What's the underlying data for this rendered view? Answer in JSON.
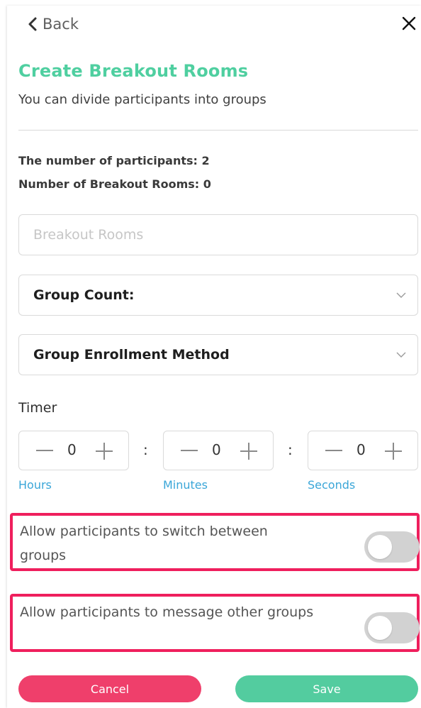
{
  "nav": {
    "back_label": "Back"
  },
  "header": {
    "title": "Create Breakout Rooms",
    "subtitle": "You can divide participants into groups"
  },
  "stats": {
    "participants": "The number of participants: 2",
    "rooms": "Number of Breakout Rooms: 0"
  },
  "form": {
    "name_placeholder": "Breakout Rooms",
    "group_count_label": "Group Count:",
    "enrollment_label": "Group Enrollment Method"
  },
  "timer": {
    "label": "Timer",
    "hours": {
      "value": "0",
      "label": "Hours"
    },
    "minutes": {
      "value": "0",
      "label": "Minutes"
    },
    "seconds": {
      "value": "0",
      "label": "Seconds"
    },
    "separator": ":"
  },
  "toggles": [
    {
      "label": "Allow participants to switch between groups",
      "on": false
    },
    {
      "label": "Allow participants to message other groups",
      "on": false
    }
  ],
  "actions": {
    "cancel_label": "Cancel",
    "save_label": "Save"
  },
  "colors": {
    "accent": "#4fcfa0",
    "save": "#53cc9f",
    "cancel": "#ef3f6b",
    "highlight": "#ef1f5d",
    "link": "#3aa6d8"
  },
  "icons": [
    "chevron-left-icon",
    "close-icon",
    "chevron-down-icon",
    "minus-icon",
    "plus-icon"
  ]
}
